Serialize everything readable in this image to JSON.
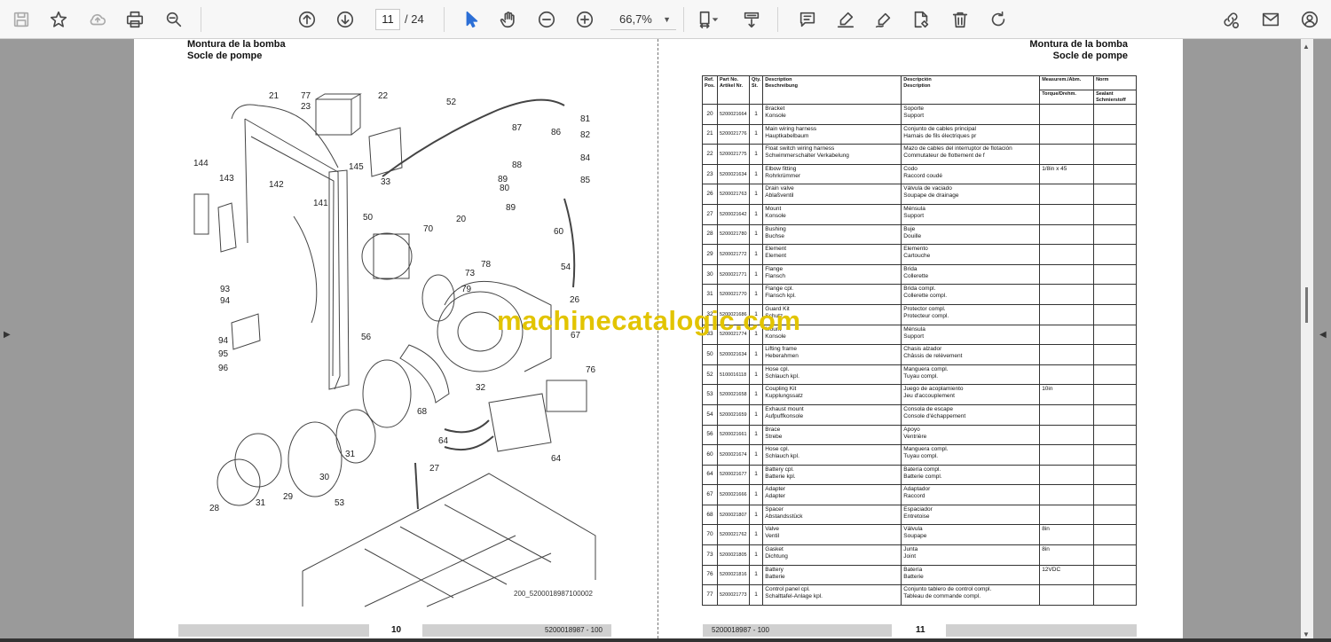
{
  "toolbar": {
    "current_page": "11",
    "total_pages": "/ 24",
    "zoom": "66,7%"
  },
  "left_page": {
    "title_es": "Montura de la bomba",
    "title_fr": "Socle de pompe",
    "drawing_id": "200_5200018987100002",
    "footer_page": "10",
    "footer_doc": "5200018987 - 100",
    "callouts": [
      "21",
      "77",
      "23",
      "22",
      "52",
      "81",
      "87",
      "86",
      "82",
      "84",
      "144",
      "143",
      "142",
      "145",
      "33",
      "88",
      "89",
      "80",
      "85",
      "141",
      "50",
      "20",
      "70",
      "89",
      "60",
      "78",
      "73",
      "79",
      "54",
      "26",
      "93",
      "94",
      "67",
      "94",
      "95",
      "96",
      "56",
      "76",
      "32",
      "68",
      "64",
      "31",
      "27",
      "30",
      "64",
      "29",
      "28",
      "31",
      "53"
    ]
  },
  "right_page": {
    "title_es": "Montura de la bomba",
    "title_fr": "Socle de pompe",
    "footer_doc": "5200018987 - 100",
    "footer_page": "11",
    "headers": {
      "ref": [
        "Ref.",
        "Pos."
      ],
      "part": [
        "Part No.",
        "Artikel Nr."
      ],
      "qty": [
        "Qty.",
        "St."
      ],
      "desc": [
        "Description",
        "Beschreibung"
      ],
      "desc2": [
        "Descripción",
        "Description"
      ],
      "meas": "Measurem./Abm.",
      "torque": "Torque/Drehm.",
      "norm": "Norm",
      "sealant": [
        "Sealant",
        "Schmierstoff"
      ]
    },
    "rows": [
      {
        "ref": "20",
        "part": "5200021664",
        "qty": "1",
        "d1": "Bracket",
        "d2": "Konsole",
        "d3": "Soporte",
        "d4": "Support",
        "meas": ""
      },
      {
        "ref": "21",
        "part": "5200021776",
        "qty": "1",
        "d1": "Main wiring harness",
        "d2": "Hauptkabelbaum",
        "d3": "Conjunto de cables principal",
        "d4": "Harnais de fils électriques pr",
        "meas": ""
      },
      {
        "ref": "22",
        "part": "5200021775",
        "qty": "1",
        "d1": "Float switch wiring harness",
        "d2": "Schwimmerschalter Verkabelung",
        "d3": "Mazo de cables del interruptor de flotación",
        "d4": "Commutateur de flottement de f",
        "meas": ""
      },
      {
        "ref": "23",
        "part": "5200021634",
        "qty": "1",
        "d1": "Elbow fitting",
        "d2": "Rohrkrümmer",
        "d3": "Codo",
        "d4": "Raccord coudé",
        "meas": "1/8in x 45"
      },
      {
        "ref": "26",
        "part": "5200021763",
        "qty": "1",
        "d1": "Drain valve",
        "d2": "Ablaßventil",
        "d3": "Válvula de vaciado",
        "d4": "Soupape de drainage",
        "meas": ""
      },
      {
        "ref": "27",
        "part": "5200021642",
        "qty": "1",
        "d1": "Mount",
        "d2": "Konsole",
        "d3": "Ménsula",
        "d4": "Support",
        "meas": ""
      },
      {
        "ref": "28",
        "part": "5200021780",
        "qty": "1",
        "d1": "Bushing",
        "d2": "Buchse",
        "d3": "Buje",
        "d4": "Douille",
        "meas": ""
      },
      {
        "ref": "29",
        "part": "5200021772",
        "qty": "1",
        "d1": "Element",
        "d2": "Element",
        "d3": "Elemento",
        "d4": "Cartouche",
        "meas": ""
      },
      {
        "ref": "30",
        "part": "5200021771",
        "qty": "1",
        "d1": "Flange",
        "d2": "Flansch",
        "d3": "Brida",
        "d4": "Collerette",
        "meas": ""
      },
      {
        "ref": "31",
        "part": "5200021770",
        "qty": "1",
        "d1": "Flange cpl.",
        "d2": "Flansch kpl.",
        "d3": "Brida compl.",
        "d4": "Collerette compl.",
        "meas": ""
      },
      {
        "ref": "32",
        "part": "5200021686",
        "qty": "1",
        "d1": "Guard Kit",
        "d2": "Schutz",
        "d3": "Protector compl.",
        "d4": "Protecteur compl.",
        "meas": ""
      },
      {
        "ref": "33",
        "part": "5200021774",
        "qty": "1",
        "d1": "Mount",
        "d2": "Konsole",
        "d3": "Ménsula",
        "d4": "Support",
        "meas": ""
      },
      {
        "ref": "50",
        "part": "5200021634",
        "qty": "1",
        "d1": "Lifting frame",
        "d2": "Heberahmen",
        "d3": "Chasis alzador",
        "d4": "Châssis de relèvement",
        "meas": ""
      },
      {
        "ref": "52",
        "part": "5100016118",
        "qty": "1",
        "d1": "Hose cpl.",
        "d2": "Schlauch kpl.",
        "d3": "Manguera compl.",
        "d4": "Tuyau compl.",
        "meas": ""
      },
      {
        "ref": "53",
        "part": "5200021658",
        "qty": "1",
        "d1": "Coupling Kit",
        "d2": "Kupplungssatz",
        "d3": "Juego de acoplamiento",
        "d4": "Jeu d'accouplement",
        "meas": "10in"
      },
      {
        "ref": "54",
        "part": "5200021659",
        "qty": "1",
        "d1": "Exhaust mount",
        "d2": "Aufpuffkonsole",
        "d3": "Consola de escape",
        "d4": "Console d'échappement",
        "meas": ""
      },
      {
        "ref": "56",
        "part": "5200021661",
        "qty": "1",
        "d1": "Brace",
        "d2": "Strebe",
        "d3": "Apoyo",
        "d4": "Ventrière",
        "meas": ""
      },
      {
        "ref": "60",
        "part": "5200021674",
        "qty": "1",
        "d1": "Hose cpl.",
        "d2": "Schlauch kpl.",
        "d3": "Manguera compl.",
        "d4": "Tuyau compl.",
        "meas": ""
      },
      {
        "ref": "64",
        "part": "5200021677",
        "qty": "1",
        "d1": "Battery cpl.",
        "d2": "Batterie kpl.",
        "d3": "Batería compl.",
        "d4": "Batterie compl.",
        "meas": ""
      },
      {
        "ref": "67",
        "part": "5200021666",
        "qty": "1",
        "d1": "Adapter",
        "d2": "Adapter",
        "d3": "Adaptador",
        "d4": "Raccord",
        "meas": ""
      },
      {
        "ref": "68",
        "part": "5200021807",
        "qty": "1",
        "d1": "Spacer",
        "d2": "Abstandsstück",
        "d3": "Espaciador",
        "d4": "Entretoise",
        "meas": ""
      },
      {
        "ref": "70",
        "part": "5200021762",
        "qty": "1",
        "d1": "Valve",
        "d2": "Ventil",
        "d3": "Válvula",
        "d4": "Soupape",
        "meas": "8in"
      },
      {
        "ref": "73",
        "part": "5200021805",
        "qty": "1",
        "d1": "Gasket",
        "d2": "Dichtung",
        "d3": "Junta",
        "d4": "Joint",
        "meas": "8in"
      },
      {
        "ref": "76",
        "part": "5200021816",
        "qty": "1",
        "d1": "Battery",
        "d2": "Batterie",
        "d3": "Batería",
        "d4": "Batterie",
        "meas": "12VDC"
      },
      {
        "ref": "77",
        "part": "5200021773",
        "qty": "1",
        "d1": "Control panel cpl.",
        "d2": "Schalttafel-Anlage kpl.",
        "d3": "Conjunto tablero de control compl.",
        "d4": "Tableau de commande compl.",
        "meas": ""
      }
    ]
  },
  "watermark": "machinecatalogic.com"
}
